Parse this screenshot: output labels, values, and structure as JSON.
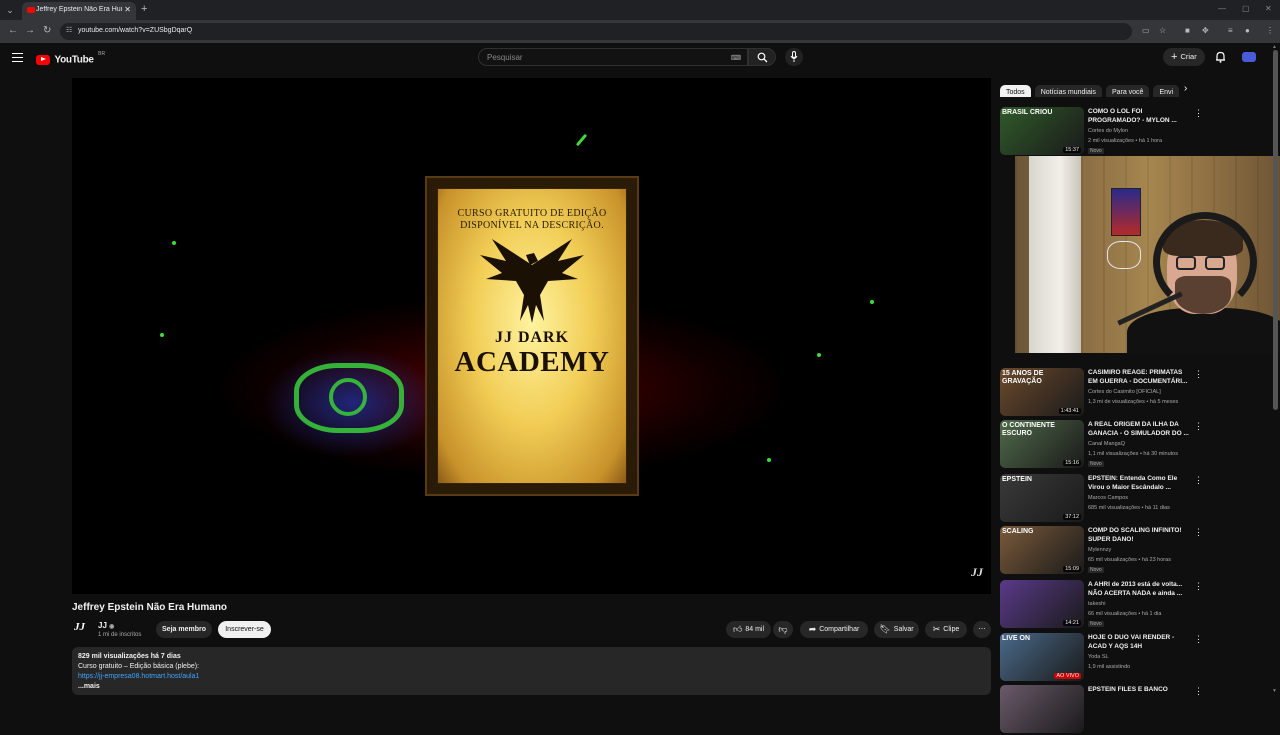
{
  "browser": {
    "tab_title": "Jeffrey Epstein Não Era Humano",
    "url": "youtube.com/watch?v=ZUSbgDqarQ"
  },
  "header": {
    "logo_text": "YouTube",
    "logo_country": "BR",
    "search_placeholder": "Pesquisar",
    "create_label": "Criar"
  },
  "player": {
    "poster_course": "CURSO GRATUITO DE EDIÇÃO DISPONÍVEL NA DESCRIÇÃO.",
    "poster_jj": "JJ DARK",
    "poster_academy": "ACADEMY",
    "watermark": "JJ"
  },
  "video": {
    "title": "Jeffrey Epstein Não Era Humano",
    "channel_name": "JJ",
    "channel_initials": "JJ",
    "subscribers": "1 mi de inscritos",
    "member_label": "Seja membro",
    "subscribe_label": "Inscrever-se",
    "likes": "84 mil",
    "share_label": "Compartilhar",
    "save_label": "Salvar",
    "clip_label": "Clipe"
  },
  "description": {
    "meta": "829 mil visualizações  há 7 dias",
    "line1": "Curso gratuito – Edição básica (plebe):",
    "link": "https://jj-empresa08.hotmart.host/aula1",
    "more": "...mais"
  },
  "sidebar": {
    "chips": [
      "Todos",
      "Notícias mundiais",
      "Para você",
      "Envi"
    ],
    "recs": [
      {
        "title": "COMO O LOL FOI PROGRAMADO? - MYLON ...",
        "channel": "Cortes do Mylon",
        "stats": "2 mil visualizações • há 1 hora",
        "badge": "Novo",
        "duration": "15:37",
        "thumb_color": "#2f5a2a",
        "thumb_text": "BRASIL CRIOU"
      },
      {
        "title": "CASIMIRO REAGE: PRIMATAS EM GUERRA - DOCUMENTÁRI...",
        "channel": "Cortes do Casimito [OFICIAL]",
        "stats": "1,3 mi de visualizações • há 5 meses",
        "badge": "",
        "duration": "1:43:41",
        "thumb_color": "#6b4a2c",
        "thumb_text": "15 ANOS DE GRAVAÇÃO"
      },
      {
        "title": "A REAL ORIGEM DA ILHA DA GANACIA - O SIMULADOR DO ...",
        "channel": "Canal MangaQ",
        "stats": "1,1 mil visualizações • há 30 minutos",
        "badge": "Novo",
        "duration": "15:16",
        "thumb_color": "#4f6a4a",
        "thumb_text": "O CONTINENTE ESCURO"
      },
      {
        "title": "EPSTEIN: Entenda Como Ele Virou o Maior Escândalo ...",
        "channel": "Marcos Campos",
        "stats": "685 mil visualizações • há 11 dias",
        "badge": "",
        "duration": "37:12",
        "thumb_color": "#3a3a3a",
        "thumb_text": "EPSTEIN"
      },
      {
        "title": "COMP DO SCALING INFINITO! SUPER DANO!",
        "channel": "Mylennzy",
        "stats": "65 mil visualizações • há 23 horas",
        "badge": "Novo",
        "duration": "15:09",
        "thumb_color": "#7a5a3a",
        "thumb_text": "SCALING"
      },
      {
        "title": "A AHRI de 2013 está de volta... NÃO ACERTA NADA e ainda ...",
        "channel": "takeshi",
        "stats": "66 mil visualizações • há 1 dia",
        "badge": "Novo",
        "duration": "14:21",
        "thumb_color": "#5a3a8a",
        "thumb_text": ""
      },
      {
        "title": "HOJE O DUO VAI RENDER - ACAD Y AQS 14H",
        "channel": "Yoda SL",
        "stats": "1,9 mil assistindo",
        "badge": "",
        "duration": "AO VIVO",
        "thumb_color": "#4a6a8a",
        "thumb_text": "LIVE ON"
      },
      {
        "title": "EPSTEIN FILES E BANCO",
        "channel": "",
        "stats": "",
        "badge": "",
        "duration": "",
        "thumb_color": "#6a5a6a",
        "thumb_text": ""
      }
    ]
  }
}
